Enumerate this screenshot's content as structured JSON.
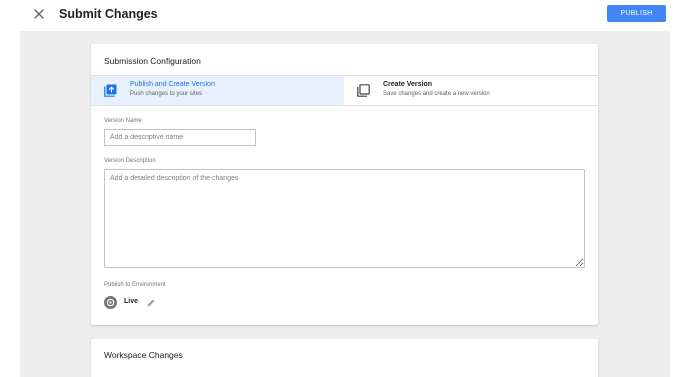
{
  "header": {
    "title": "Submit Changes",
    "close_icon": "close-icon",
    "publish_label": "PUBLISH",
    "accent_color": "#4285f4"
  },
  "submission_config": {
    "heading": "Submission Configuration",
    "options": [
      {
        "title": "Publish and Create Version",
        "subtitle": "Push changes to your sites",
        "icon": "publish-icon",
        "selected": true
      },
      {
        "title": "Create Version",
        "subtitle": "Save changes and create a new version",
        "icon": "copy-icon",
        "selected": false
      }
    ],
    "version_name": {
      "label": "Version Name",
      "value": "",
      "placeholder": "Add a descriptive name"
    },
    "version_description": {
      "label": "Version Description",
      "value": "",
      "placeholder": "Add a detailed description of the changes"
    },
    "environment": {
      "label": "Publish to Environment",
      "name": "Live",
      "icon": "live-environment-icon",
      "edit_icon": "pencil-icon"
    }
  },
  "workspace_changes": {
    "heading": "Workspace Changes"
  }
}
